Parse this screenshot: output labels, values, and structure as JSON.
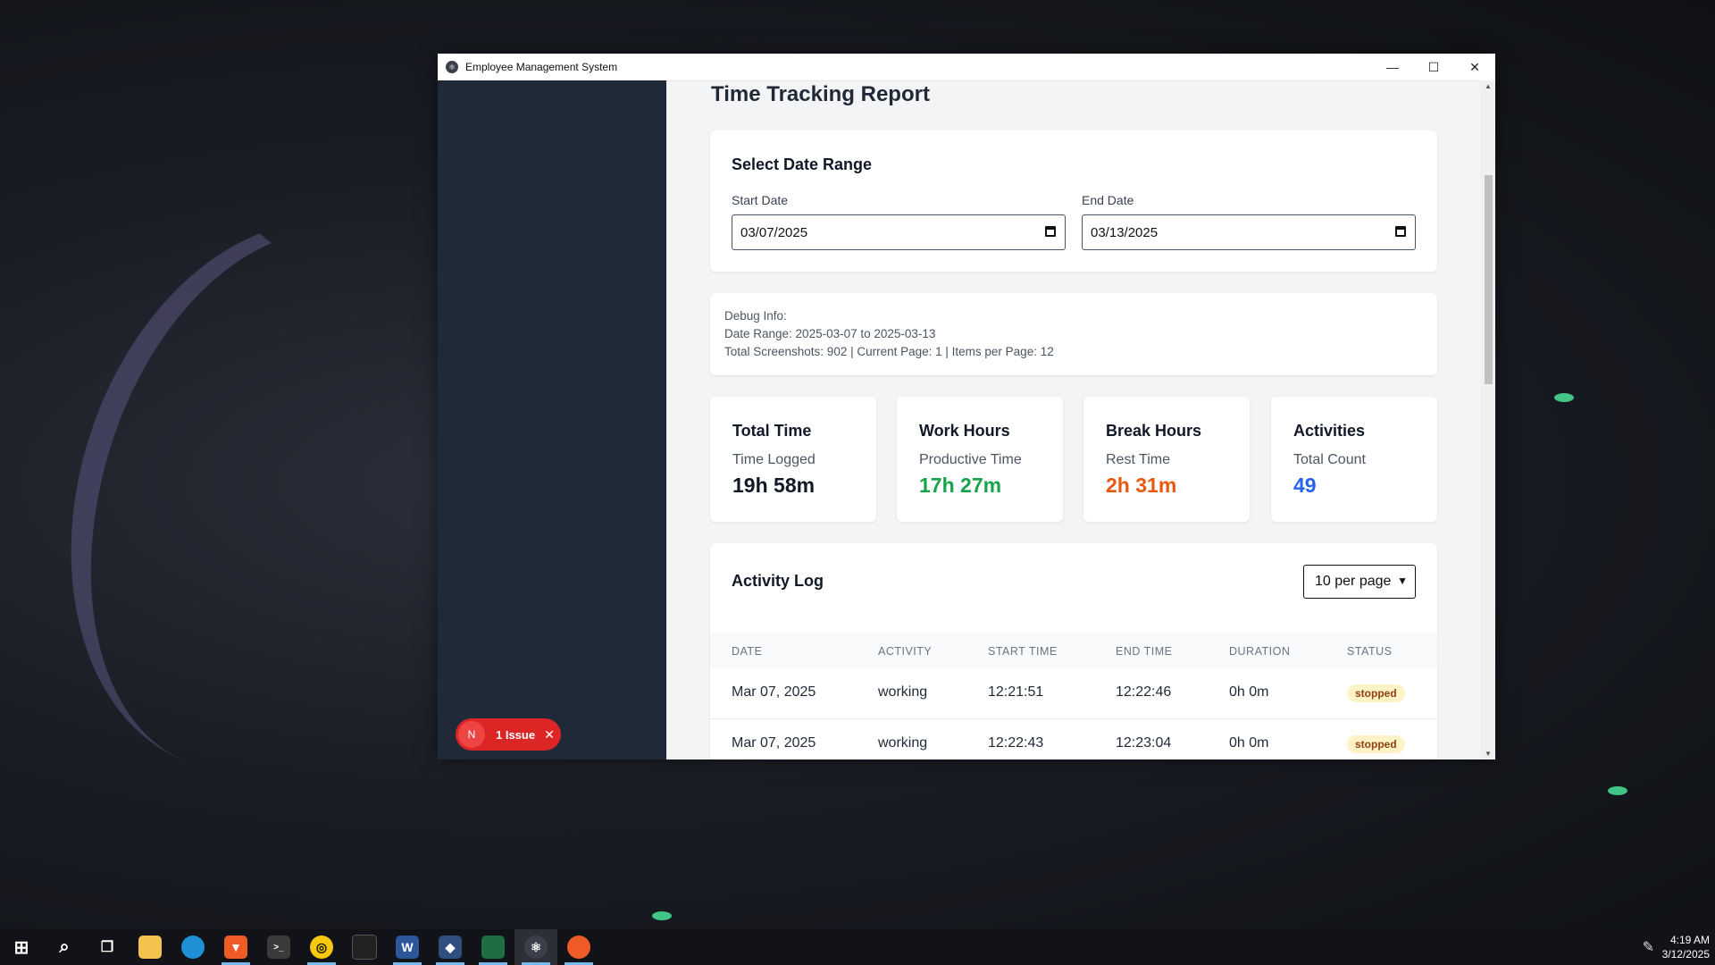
{
  "window": {
    "title": "Employee Management System",
    "controls": {
      "minimize": "—",
      "maximize": "☐",
      "close": "✕"
    }
  },
  "issue_badge": {
    "initial": "N",
    "label": "1 Issue",
    "close": "✕"
  },
  "page": {
    "title": "Time Tracking Report"
  },
  "date_range": {
    "heading": "Select Date Range",
    "start_label": "Start Date",
    "start_value": "03/07/2025",
    "end_label": "End Date",
    "end_value": "03/13/2025"
  },
  "debug": {
    "line1": "Debug Info:",
    "line2": "Date Range: 2025-03-07 to 2025-03-13",
    "line3": "Total Screenshots: 902 | Current Page: 1 | Items per Page: 12"
  },
  "stats": [
    {
      "title": "Total Time",
      "subtitle": "Time Logged",
      "value": "19h 58m",
      "color": "#111827"
    },
    {
      "title": "Work Hours",
      "subtitle": "Productive Time",
      "value": "17h 27m",
      "color": "#16a34a"
    },
    {
      "title": "Break Hours",
      "subtitle": "Rest Time",
      "value": "2h 31m",
      "color": "#ea580c"
    },
    {
      "title": "Activities",
      "subtitle": "Total Count",
      "value": "49",
      "color": "#2563eb"
    }
  ],
  "activity_log": {
    "heading": "Activity Log",
    "per_page": "10 per page",
    "columns": [
      "DATE",
      "ACTIVITY",
      "START TIME",
      "END TIME",
      "DURATION",
      "STATUS"
    ],
    "rows": [
      {
        "date": "Mar 07, 2025",
        "activity": "working",
        "start": "12:21:51",
        "end": "12:22:46",
        "duration": "0h 0m",
        "status": "stopped"
      },
      {
        "date": "Mar 07, 2025",
        "activity": "working",
        "start": "12:22:43",
        "end": "12:23:04",
        "duration": "0h 0m",
        "status": "stopped"
      }
    ]
  },
  "taskbar": {
    "icons": [
      "windows-icon",
      "search-icon",
      "task-view-icon",
      "file-explorer-icon",
      "edge-icon",
      "brave-icon",
      "terminal-icon",
      "app-icon",
      "cursor-icon",
      "word-icon",
      "vscode-icon",
      "excel-icon",
      "electron-icon",
      "postman-icon"
    ],
    "time": "4:19 AM",
    "date": "3/12/2025"
  }
}
